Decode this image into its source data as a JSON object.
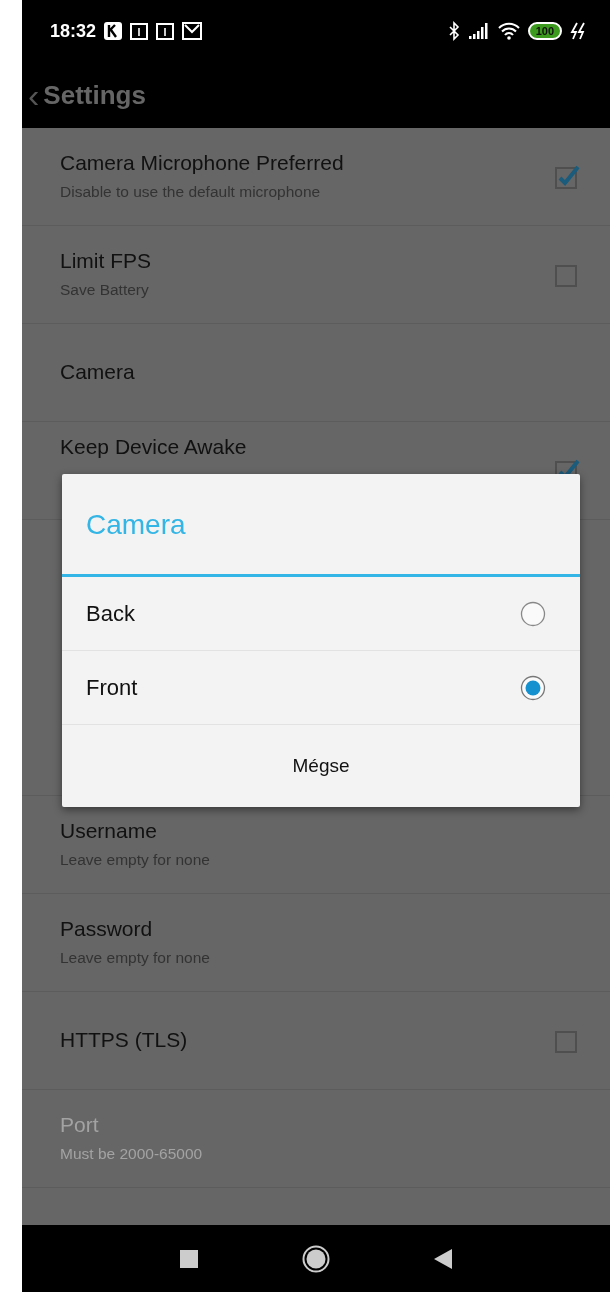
{
  "status_bar": {
    "time": "18:32",
    "battery": "100"
  },
  "app_bar": {
    "back": "‹",
    "title": "Settings"
  },
  "settings": [
    {
      "kind": "checkbox",
      "title": "Camera Microphone Preferred",
      "summary": "Disable to use the default microphone",
      "checked": true,
      "disabled": false
    },
    {
      "kind": "checkbox",
      "title": "Limit FPS",
      "summary": "Save Battery",
      "checked": false,
      "disabled": false
    },
    {
      "kind": "text",
      "title": "Camera",
      "disabled": false
    },
    {
      "kind": "checkbox",
      "title": "Keep Device Awake",
      "checked": true,
      "disabled": false
    }
  ],
  "settings_below_dialog": [
    {
      "kind": "text",
      "title": "Username",
      "summary": "Leave empty for none",
      "disabled": false
    },
    {
      "kind": "text",
      "title": "Password",
      "summary": "Leave empty for none",
      "disabled": false
    },
    {
      "kind": "checkbox",
      "title": "HTTPS (TLS)",
      "checked": false,
      "disabled": false
    },
    {
      "kind": "text",
      "title": "Port",
      "summary": "Must be 2000-65000",
      "disabled": true
    }
  ],
  "dialog": {
    "title": "Camera",
    "options": [
      {
        "label": "Back",
        "selected": false
      },
      {
        "label": "Front",
        "selected": true
      }
    ],
    "cancel": "Mégse"
  }
}
